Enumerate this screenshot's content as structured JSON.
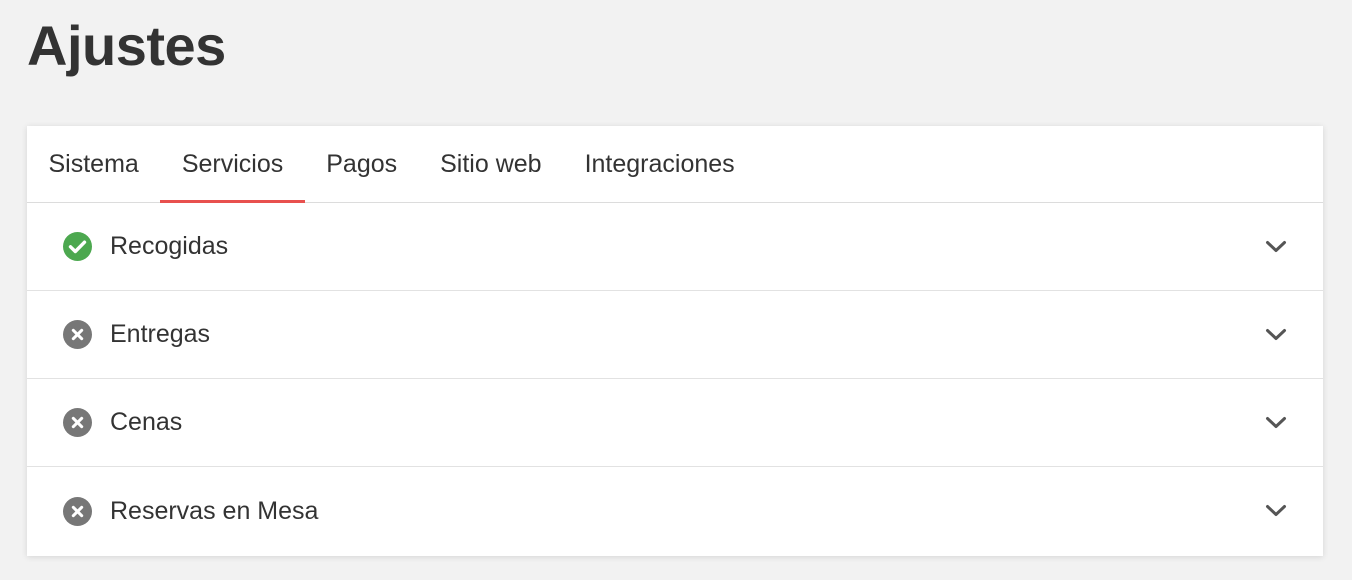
{
  "page": {
    "title": "Ajustes"
  },
  "tabs": [
    {
      "label": "Sistema",
      "active": false
    },
    {
      "label": "Servicios",
      "active": true
    },
    {
      "label": "Pagos",
      "active": false
    },
    {
      "label": "Sitio web",
      "active": false
    },
    {
      "label": "Integraciones",
      "active": false
    }
  ],
  "services": [
    {
      "label": "Recogidas",
      "status": "enabled",
      "icon": "check-circle-icon"
    },
    {
      "label": "Entregas",
      "status": "disabled",
      "icon": "x-circle-icon"
    },
    {
      "label": "Cenas",
      "status": "disabled",
      "icon": "x-circle-icon"
    },
    {
      "label": "Reservas en Mesa",
      "status": "disabled",
      "icon": "x-circle-icon"
    }
  ],
  "colors": {
    "accent": "#e8504e",
    "enabled": "#4ca84f",
    "disabled": "#777777",
    "background": "#f2f2f2"
  }
}
